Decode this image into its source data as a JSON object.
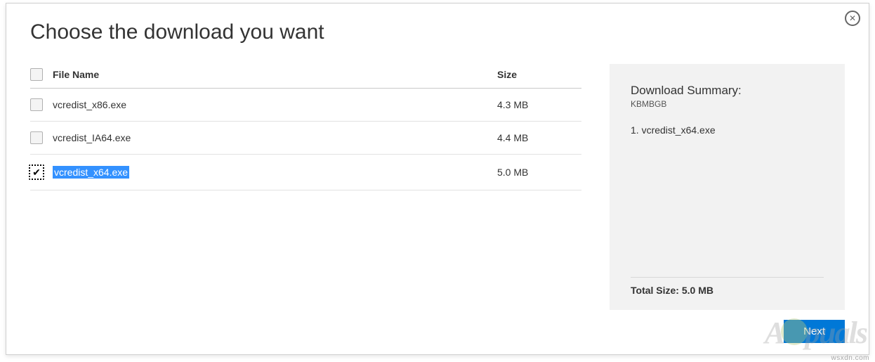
{
  "title": "Choose the download you want",
  "table": {
    "header_name": "File Name",
    "header_size": "Size",
    "rows": [
      {
        "name": "vcredist_x86.exe",
        "size": "4.3 MB",
        "checked": false,
        "highlight": false
      },
      {
        "name": "vcredist_IA64.exe",
        "size": "4.4 MB",
        "checked": false,
        "highlight": false
      },
      {
        "name": "vcredist_x64.exe",
        "size": "5.0 MB",
        "checked": true,
        "highlight": true
      }
    ]
  },
  "summary": {
    "title": "Download Summary:",
    "subtitle": "KBMBGB",
    "items": [
      "1.  vcredist_x64.exe"
    ],
    "total_label": "Total Size: 5.0 MB"
  },
  "next_label": "Next",
  "watermark_domain": "wsxdn.com",
  "watermark_logo_pre": "A",
  "watermark_logo_post": "puals"
}
